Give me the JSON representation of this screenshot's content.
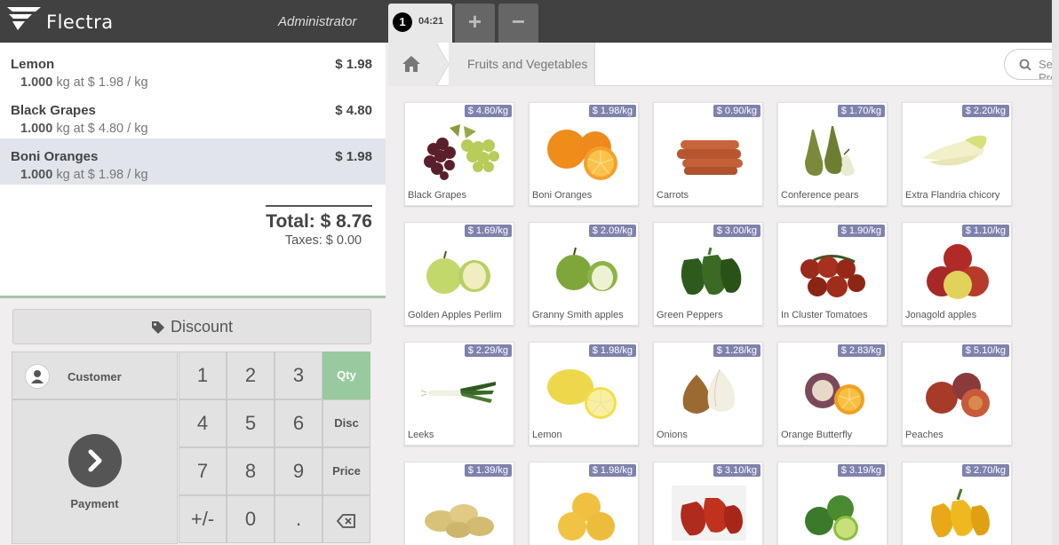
{
  "app": {
    "brand": "Flectra",
    "user": "Administrator"
  },
  "session": {
    "order_number": "1",
    "order_time": "04:21",
    "add_label": "+",
    "remove_label": "−"
  },
  "order": {
    "lines": [
      {
        "name": "Lemon",
        "price": "$ 1.98",
        "qty": "1.000",
        "info": " kg at $ 1.98 / kg"
      },
      {
        "name": "Black Grapes",
        "price": "$ 4.80",
        "qty": "1.000",
        "info": " kg at $ 4.80 / kg"
      },
      {
        "name": "Boni Oranges",
        "price": "$ 1.98",
        "qty": "1.000",
        "info": " kg at $ 1.98 / kg"
      }
    ],
    "total": "Total: $ 8.76",
    "taxes": "Taxes: $ 0.00"
  },
  "controls": {
    "discount": "Discount",
    "customer": "Customer",
    "payment": "Payment",
    "numpad": [
      "1",
      "2",
      "3",
      "Qty",
      "4",
      "5",
      "6",
      "Disc",
      "7",
      "8",
      "9",
      "Price",
      "+/-",
      "0",
      "."
    ],
    "active_mode": "Qty",
    "backspace_icon": "backspace-icon"
  },
  "breadcrumb": {
    "home_icon": "home-icon",
    "category": "Fruits and Vegetables"
  },
  "search": {
    "placeholder": "Search Products"
  },
  "products": [
    {
      "name": "Black Grapes",
      "price": "$ 4.80/kg"
    },
    {
      "name": "Boni Oranges",
      "price": "$ 1.98/kg"
    },
    {
      "name": "Carrots",
      "price": "$ 0.90/kg"
    },
    {
      "name": "Conference pears",
      "price": "$ 1.70/kg"
    },
    {
      "name": "Extra Flandria chicory",
      "price": "$ 2.20/kg"
    },
    {
      "name": "Golden Apples Perlim",
      "price": "$ 1.69/kg"
    },
    {
      "name": "Granny Smith apples",
      "price": "$ 2.09/kg"
    },
    {
      "name": "Green Peppers",
      "price": "$ 3.00/kg"
    },
    {
      "name": "In Cluster Tomatoes",
      "price": "$ 1.90/kg"
    },
    {
      "name": "Jonagold apples",
      "price": "$ 1.10/kg"
    },
    {
      "name": "Leeks",
      "price": "$ 2.29/kg"
    },
    {
      "name": "Lemon",
      "price": "$ 1.98/kg"
    },
    {
      "name": "Onions",
      "price": "$ 1.28/kg"
    },
    {
      "name": "Orange Butterfly",
      "price": "$ 2.83/kg"
    },
    {
      "name": "Peaches",
      "price": "$ 5.10/kg"
    },
    {
      "name": "",
      "price": "$ 1.39/kg"
    },
    {
      "name": "",
      "price": "$ 1.98/kg"
    },
    {
      "name": "",
      "price": "$ 3.10/kg"
    },
    {
      "name": "",
      "price": "$ 3.19/kg"
    },
    {
      "name": "",
      "price": "$ 2.70/kg"
    }
  ],
  "colors": {
    "topbar": "#414141",
    "accent_green": "#99c99f",
    "price_tag": "#7f82ac"
  }
}
